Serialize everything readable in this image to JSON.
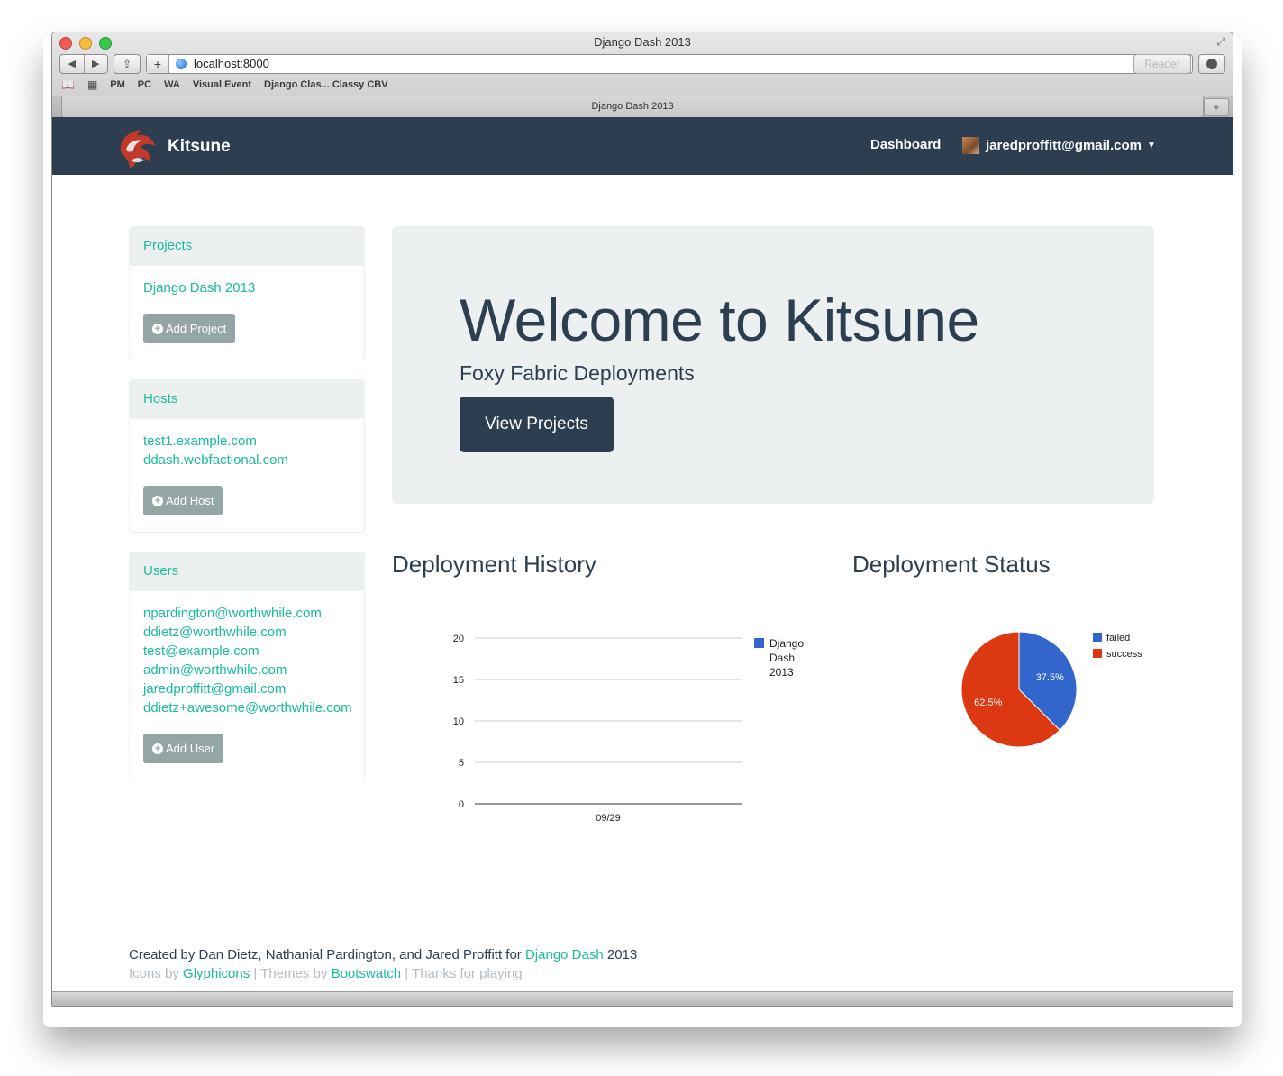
{
  "browser": {
    "window_title": "Django Dash 2013",
    "url": "localhost:8000",
    "reader_label": "Reader",
    "bookmarks": [
      "PM",
      "PC",
      "WA",
      "Visual Event",
      "Django Clas... Classy CBV"
    ],
    "tab_title": "Django Dash 2013"
  },
  "navbar": {
    "brand": "Kitsune",
    "dashboard": "Dashboard",
    "user": "jaredproffitt@gmail.com"
  },
  "sidebar": {
    "projects": {
      "title": "Projects",
      "items": [
        "Django Dash 2013"
      ],
      "button": "Add Project"
    },
    "hosts": {
      "title": "Hosts",
      "items": [
        "test1.example.com",
        "ddash.webfactional.com"
      ],
      "button": "Add Host"
    },
    "users": {
      "title": "Users",
      "items": [
        "npardington@worthwhile.com",
        "ddietz@worthwhile.com",
        "test@example.com",
        "admin@worthwhile.com",
        "jaredproffitt@gmail.com",
        "ddietz+awesome@worthwhile.com"
      ],
      "button": "Add User"
    }
  },
  "jumbotron": {
    "title": "Welcome to Kitsune",
    "subtitle": "Foxy Fabric Deployments",
    "button": "View Projects"
  },
  "history_title": "Deployment History",
  "status_title": "Deployment Status",
  "chart_data": [
    {
      "type": "line",
      "title": "Deployment History",
      "x": [
        "09/29"
      ],
      "series": [
        {
          "name": "Django Dash 2013",
          "values": [
            0
          ],
          "color": "#3366cc"
        }
      ],
      "ylim": [
        0,
        20
      ],
      "yticks": [
        0,
        5,
        10,
        15,
        20
      ],
      "grid": true,
      "legend": "right"
    },
    {
      "type": "pie",
      "title": "Deployment Status",
      "categories": [
        "failed",
        "success"
      ],
      "values": [
        37.5,
        62.5
      ],
      "labels": [
        "37.5%",
        "62.5%"
      ],
      "colors": [
        "#3366cc",
        "#dc3912"
      ],
      "legend": "top-right"
    }
  ],
  "footer": {
    "line1_prefix": "Created by Dan Dietz, Nathanial Pardington, and Jared Proffitt for ",
    "line1_link": "Django Dash",
    "line1_suffix": " 2013",
    "icons_prefix": "Icons by ",
    "icons_link": "Glyphicons",
    "sep1": " | Themes by ",
    "themes_link": "Bootswatch",
    "sep2": " | Thanks for playing"
  },
  "colors": {
    "navbar": "#2c3e50",
    "link": "#18bc9c",
    "muted_button": "#95a5a6",
    "jumbotron": "#ecf0f1"
  }
}
